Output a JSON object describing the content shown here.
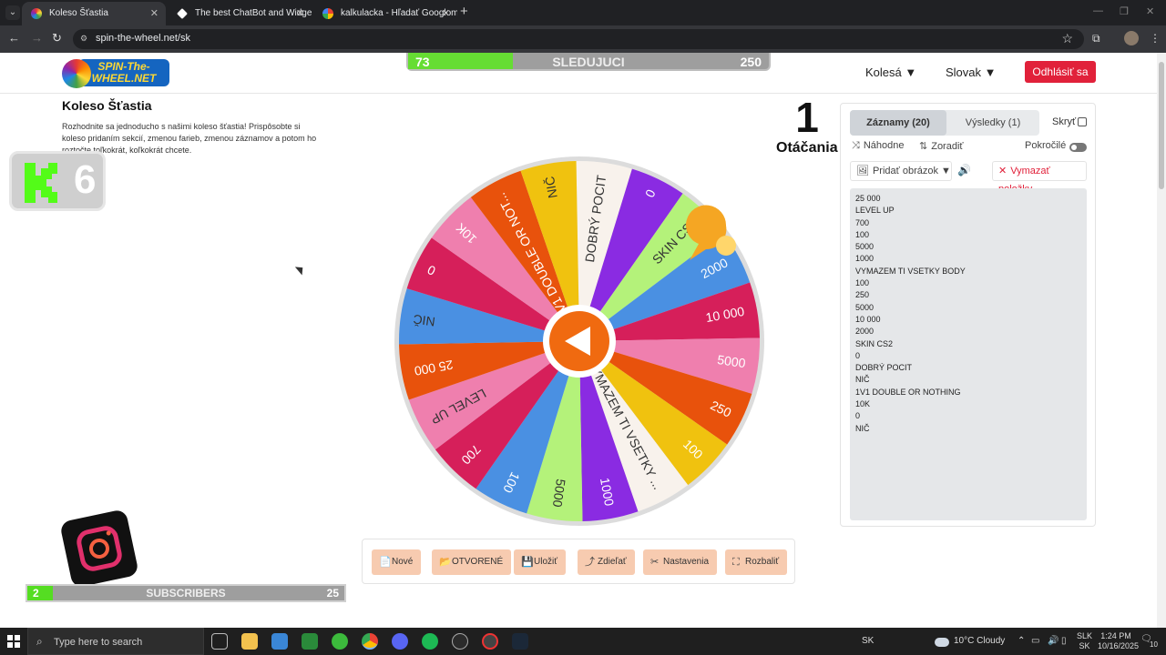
{
  "browser": {
    "tabs": [
      {
        "title": "Koleso Šťastia",
        "active": true
      },
      {
        "title": "The best ChatBot and Widgets",
        "active": false
      },
      {
        "title": "kalkulacka - Hľadať Googlom",
        "active": false
      }
    ],
    "url": "spin-the-wheel.net/sk",
    "new_tab": "+",
    "close_tab": "✕"
  },
  "header": {
    "logo_text": "SPIN-The-WHEEL.NET",
    "follow_bar": {
      "current": "73",
      "label": "SLEDUJUCI",
      "goal": "250",
      "progress": 0.29
    },
    "nav_wheels": "Kolesá ▼",
    "nav_language": "Slovak ▼",
    "logout": "Odhlásiť sa"
  },
  "main": {
    "title": "Koleso Šťastia",
    "description": "Rozhodnite sa jednoducho s našimi koleso šťastia! Prispôsobte si koleso pridaním sekcií, zmenou farieb, zmenou záznamov a potom ho roztočte toľkokrát, koľkokrát chcete.",
    "spin_count": "1",
    "spin_label": "Otáčania"
  },
  "overlay": {
    "k6_number": "6",
    "subs_bar": {
      "current": "2",
      "label": "SUBSCRIBERS",
      "goal": "25",
      "progress": 0.08
    }
  },
  "wheel": {
    "segments": [
      {
        "label": "DOBRÝ POCIT",
        "color": "#f8f2ec",
        "text_color": "#333"
      },
      {
        "label": "0",
        "color": "#8a2be2",
        "text_color": "#fff"
      },
      {
        "label": "SKIN CS2",
        "color": "#b4f27a",
        "text_color": "#333"
      },
      {
        "label": "2000",
        "color": "#4a90e2",
        "text_color": "#fff"
      },
      {
        "label": "10 000",
        "color": "#d61f5a",
        "text_color": "#fff"
      },
      {
        "label": "5000",
        "color": "#ef7fae",
        "text_color": "#fff"
      },
      {
        "label": "250",
        "color": "#e8520c",
        "text_color": "#fff"
      },
      {
        "label": "100",
        "color": "#f0c20f",
        "text_color": "#fff"
      },
      {
        "label": "VYMAZEM TI VSETKY ...",
        "color": "#f8f2ec",
        "text_color": "#333"
      },
      {
        "label": "1000",
        "color": "#8a2be2",
        "text_color": "#fff"
      },
      {
        "label": "5000",
        "color": "#b4f27a",
        "text_color": "#333"
      },
      {
        "label": "100",
        "color": "#4a90e2",
        "text_color": "#fff"
      },
      {
        "label": "700",
        "color": "#d61f5a",
        "text_color": "#fff"
      },
      {
        "label": "LEVEL UP",
        "color": "#ef7fae",
        "text_color": "#333"
      },
      {
        "label": "25 000",
        "color": "#e8520c",
        "text_color": "#fff"
      },
      {
        "label": "NIČ",
        "color": "#4a90e2",
        "text_color": "#333"
      },
      {
        "label": "0",
        "color": "#d61f5a",
        "text_color": "#fff"
      },
      {
        "label": "10K",
        "color": "#ef7fae",
        "text_color": "#fff"
      },
      {
        "label": "1V1 DOUBLE OR NOT...",
        "color": "#e8520c",
        "text_color": "#fff"
      },
      {
        "label": "NIČ",
        "color": "#f0c20f",
        "text_color": "#333"
      }
    ],
    "center_color": "#f06a10",
    "pin_color": "#f5a623"
  },
  "controls": [
    {
      "icon": "📄",
      "label": "Nové"
    },
    {
      "icon": "📂",
      "label": "OTVORENÉ"
    },
    {
      "icon": "💾",
      "label": "Uložiť"
    },
    {
      "icon": "⤴",
      "label": "Zdieľať"
    },
    {
      "icon": "✂",
      "label": "Nastavenia"
    },
    {
      "icon": "⛶",
      "label": "Rozbaliť"
    }
  ],
  "panel": {
    "tab_entries": "Záznamy (20)",
    "tab_results": "Výsledky (1)",
    "hide_label": "Skryť",
    "shuffle": "Náhodne",
    "sort": "Zoradiť",
    "advanced": "Pokročilé",
    "add_image": "Pridať obrázok ▼",
    "clear": "Vymazať položky",
    "entries": [
      "25 000",
      "LEVEL UP",
      "700",
      "100",
      "5000",
      "1000",
      "VYMAZEM TI VSETKY BODY",
      "100",
      "250",
      "5000",
      "10 000",
      "2000",
      "SKIN CS2",
      "0",
      "DOBRÝ POCIT",
      "NIČ",
      "1V1 DOUBLE OR NOTHING",
      "10K",
      "0",
      "NIČ"
    ]
  },
  "taskbar": {
    "search_placeholder": "Type here to search",
    "keyboard": "SK",
    "weather": "10°C Cloudy",
    "lang_top": "SLK",
    "lang_bottom": "SK",
    "time": "1:24 PM",
    "date": "10/16/2025",
    "notification_count": "10"
  }
}
